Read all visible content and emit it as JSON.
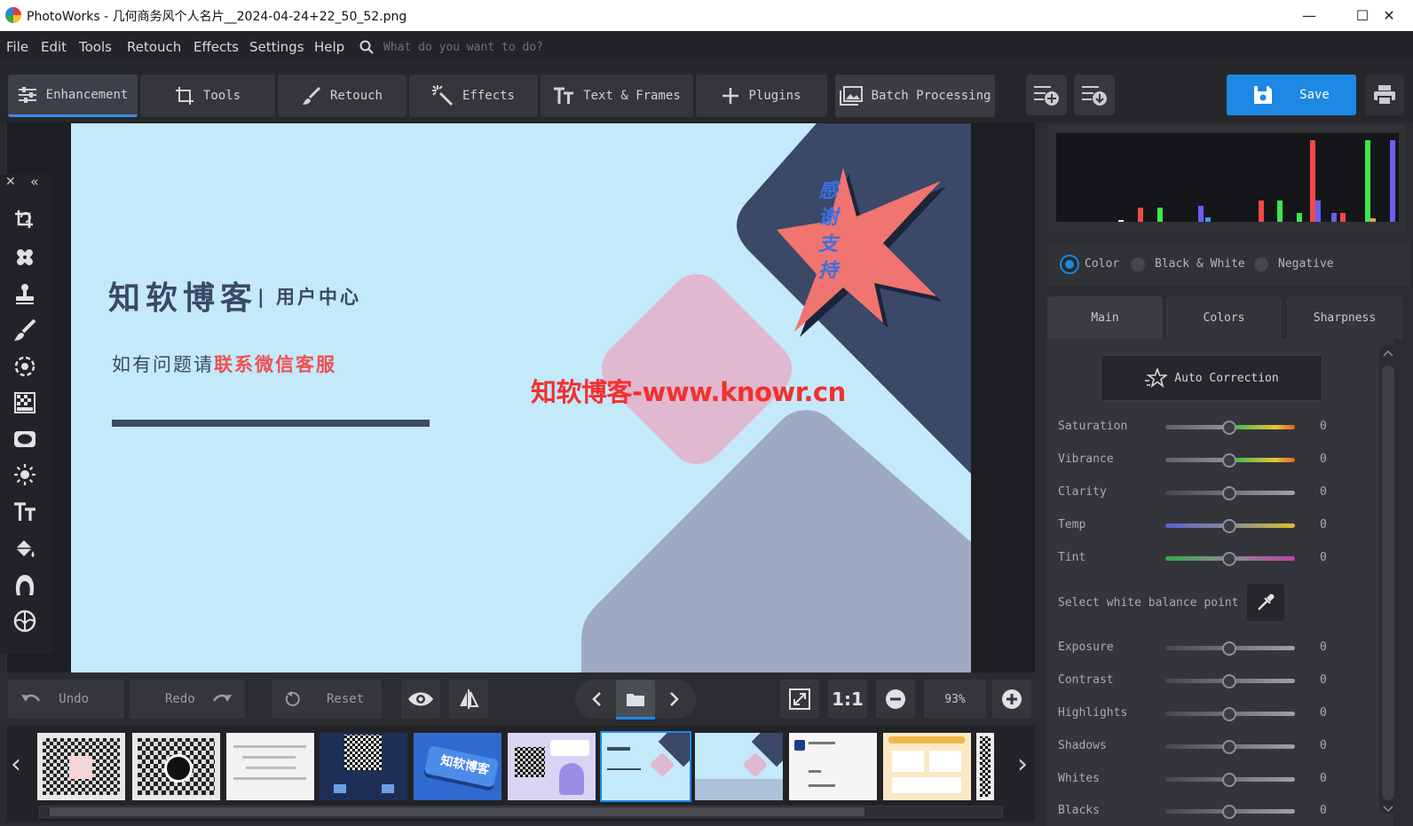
{
  "window": {
    "app_name": "PhotoWorks",
    "title": "PhotoWorks - 几何商务风个人名片__2024-04-24+22_50_52.png",
    "minimize": "—",
    "maximize": "☐",
    "close": "✕"
  },
  "menu": {
    "items": [
      "File",
      "Edit",
      "Tools",
      "Retouch",
      "Effects",
      "Settings",
      "Help"
    ],
    "search_placeholder": "What do you want to do?"
  },
  "toolbar": {
    "tabs": [
      "Enhancement",
      "Tools",
      "Retouch",
      "Effects",
      "Text & Frames",
      "Plugins"
    ],
    "active_tab": "Enhancement",
    "batch_label": "Batch Processing",
    "save_label": "Save"
  },
  "canvas": {
    "card_title": "知软博客",
    "card_subtitle": "| 用户中心",
    "card_line_prefix": "如有问题请",
    "card_line_highlight": "联系微信客服",
    "card_star_text": [
      "感",
      "谢",
      "支",
      "持"
    ],
    "watermark": "知软博客-www.knowr.cn"
  },
  "bottom": {
    "undo_label": "Undo",
    "redo_label": "Redo",
    "reset_label": "Reset",
    "zoom_ratio": "1:1",
    "zoom_value": "93%"
  },
  "filmstrip": {
    "prev": "‹",
    "next": "›",
    "thumb_count": 10,
    "selected_index": 6,
    "thumb4_text": "知软博客"
  },
  "right_panel": {
    "modes": [
      "Color",
      "Black & White",
      "Negative"
    ],
    "selected_mode": "Color",
    "tabs": [
      "Main",
      "Colors",
      "Sharpness"
    ],
    "active_tab": "Main",
    "auto_correction_label": "Auto Correction",
    "white_balance_label": "Select white balance point",
    "sliders": [
      {
        "label": "Saturation",
        "value": "0"
      },
      {
        "label": "Vibrance",
        "value": "0"
      },
      {
        "label": "Clarity",
        "value": "0"
      },
      {
        "label": "Temp",
        "value": "0"
      },
      {
        "label": "Tint",
        "value": "0"
      },
      {
        "label": "Exposure",
        "value": "0"
      },
      {
        "label": "Contrast",
        "value": "0"
      },
      {
        "label": "Highlights",
        "value": "0"
      },
      {
        "label": "Shadows",
        "value": "0"
      },
      {
        "label": "Whites",
        "value": "0"
      },
      {
        "label": "Blacks",
        "value": "0"
      }
    ]
  },
  "colors": {
    "accent": "#1e88e5",
    "card_bg": "#c4e9fb",
    "card_navy": "#3b4867",
    "card_pink": "#e0b8d0",
    "card_coral": "#f07470",
    "watermark_red": "#f2302e"
  }
}
